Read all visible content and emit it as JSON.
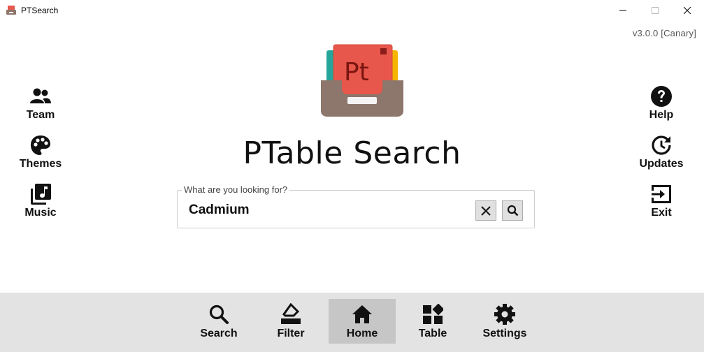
{
  "window": {
    "title": "PTSearch",
    "version": "v3.0.0 [Canary]"
  },
  "left_buttons": [
    {
      "label": "Team",
      "icon": "team-icon"
    },
    {
      "label": "Themes",
      "icon": "palette-icon"
    },
    {
      "label": "Music",
      "icon": "music-library-icon"
    }
  ],
  "right_buttons": [
    {
      "label": "Help",
      "icon": "help-icon"
    },
    {
      "label": "Updates",
      "icon": "updates-icon"
    },
    {
      "label": "Exit",
      "icon": "exit-icon"
    }
  ],
  "main": {
    "title": "PTable Search",
    "logo_text": "Pt"
  },
  "search": {
    "legend": "What are you looking for?",
    "value": "Cadmium"
  },
  "bottom_nav": {
    "active": "Home",
    "items": [
      {
        "label": "Search",
        "icon": "search-icon"
      },
      {
        "label": "Filter",
        "icon": "filter-icon"
      },
      {
        "label": "Home",
        "icon": "home-icon"
      },
      {
        "label": "Table",
        "icon": "table-icon"
      },
      {
        "label": "Settings",
        "icon": "gear-icon"
      }
    ]
  },
  "colors": {
    "nav_background": "#e3e3e3",
    "nav_active": "#c6c6c6",
    "logo_red": "#e8574b",
    "logo_tray": "#8d766c"
  }
}
